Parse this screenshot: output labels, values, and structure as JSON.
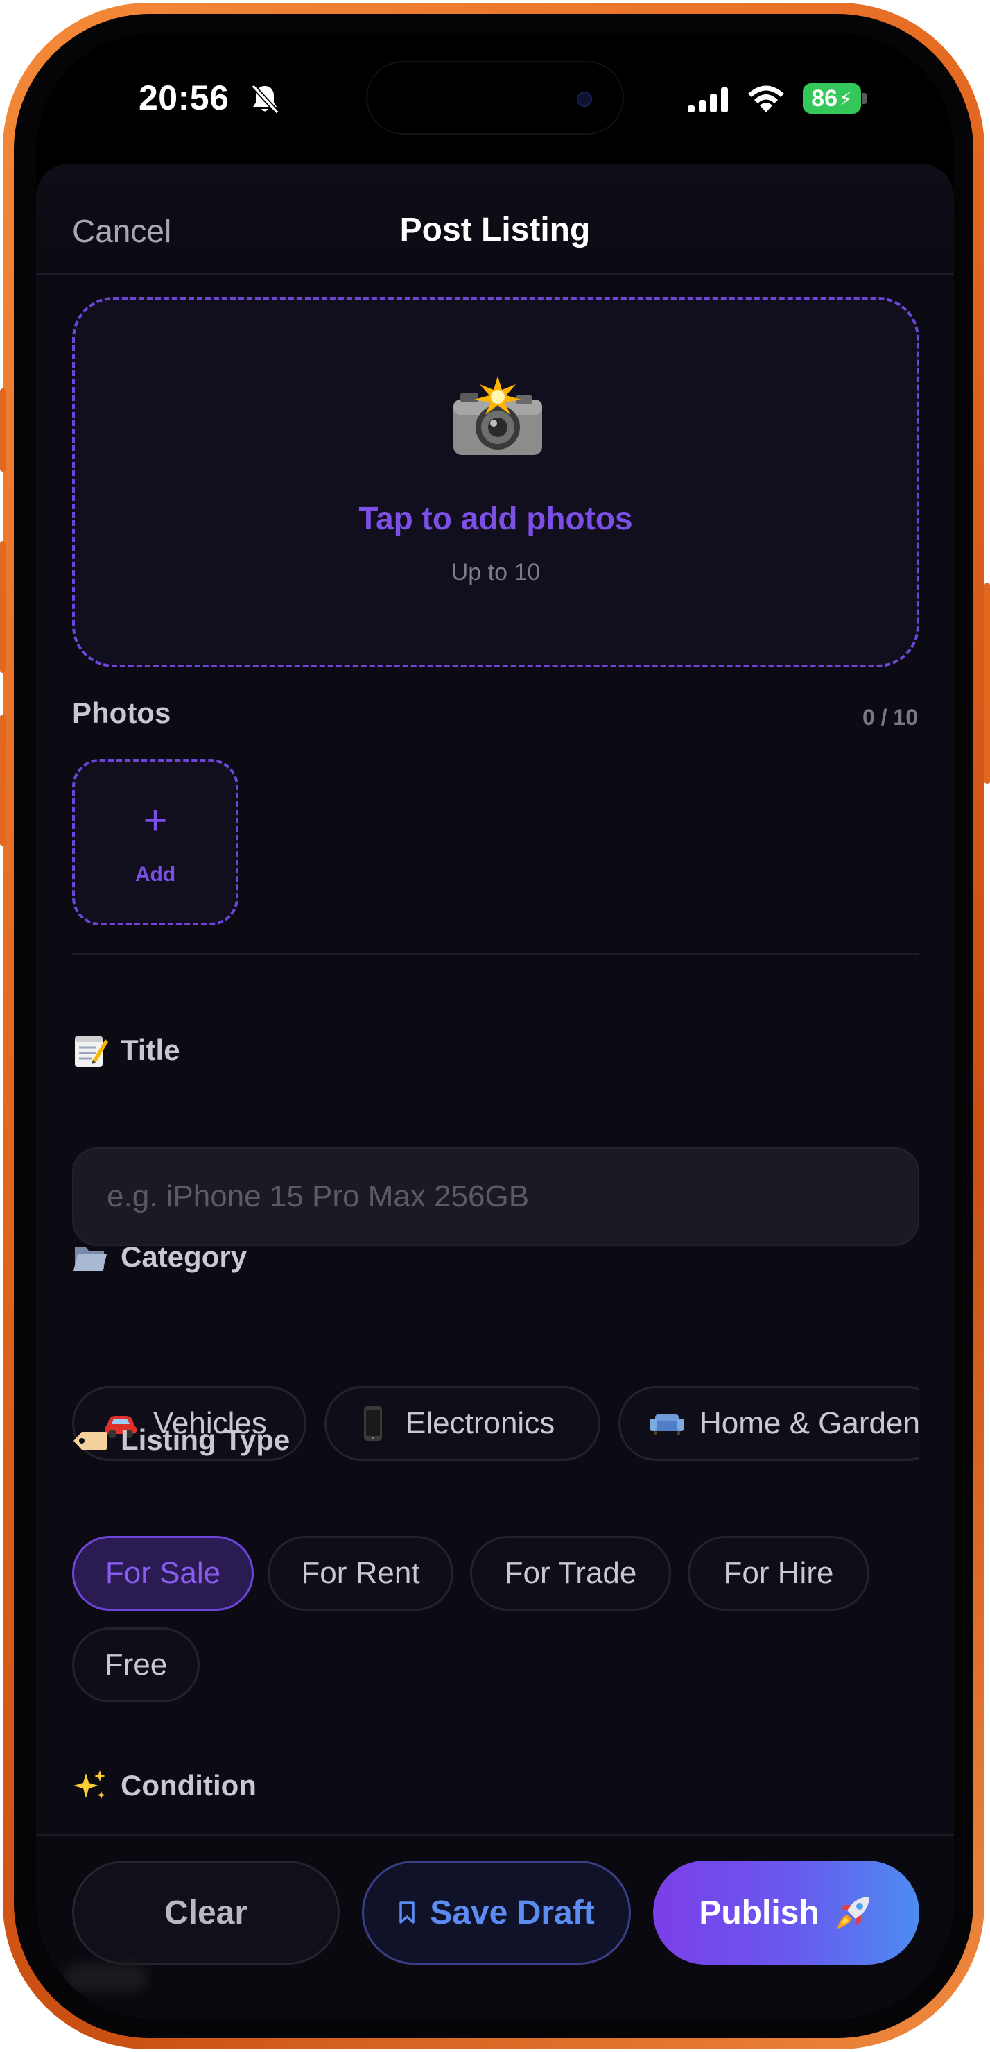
{
  "status_bar": {
    "time": "20:56",
    "battery": "86"
  },
  "nav": {
    "cancel_label": "Cancel",
    "title": "Post Listing"
  },
  "upload": {
    "title": "Tap to add photos",
    "subtitle": "Up to 10"
  },
  "photos": {
    "label": "Photos",
    "count": "0 / 10",
    "add_label": "Add"
  },
  "title_field": {
    "label": "Title",
    "placeholder": "e.g. iPhone 15 Pro Max 256GB",
    "value": ""
  },
  "category": {
    "label": "Category",
    "options": [
      "Vehicles",
      "Electronics",
      "Home & Garden"
    ]
  },
  "listing_type": {
    "label": "Listing Type",
    "options": [
      "For Sale",
      "For Rent",
      "For Trade",
      "For Hire",
      "Free"
    ],
    "selected": "For Sale"
  },
  "condition": {
    "label": "Condition"
  },
  "actions": {
    "clear_label": "Clear",
    "save_draft_label": "Save Draft",
    "publish_label": "Publish"
  },
  "colors": {
    "frame": "#e2641e",
    "background": "#0c0b14",
    "accent_purple": "#7c4fe6",
    "accent_blue": "#5c8cf2",
    "battery_green": "#34c759"
  },
  "icons": [
    "bell-slash-icon",
    "signal-icon",
    "wifi-icon",
    "battery-icon",
    "camera-flash-icon",
    "memo-icon",
    "folder-icon",
    "car-icon",
    "phone-icon",
    "couch-icon",
    "tag-icon",
    "sparkles-icon",
    "bookmark-icon",
    "rocket-icon"
  ]
}
